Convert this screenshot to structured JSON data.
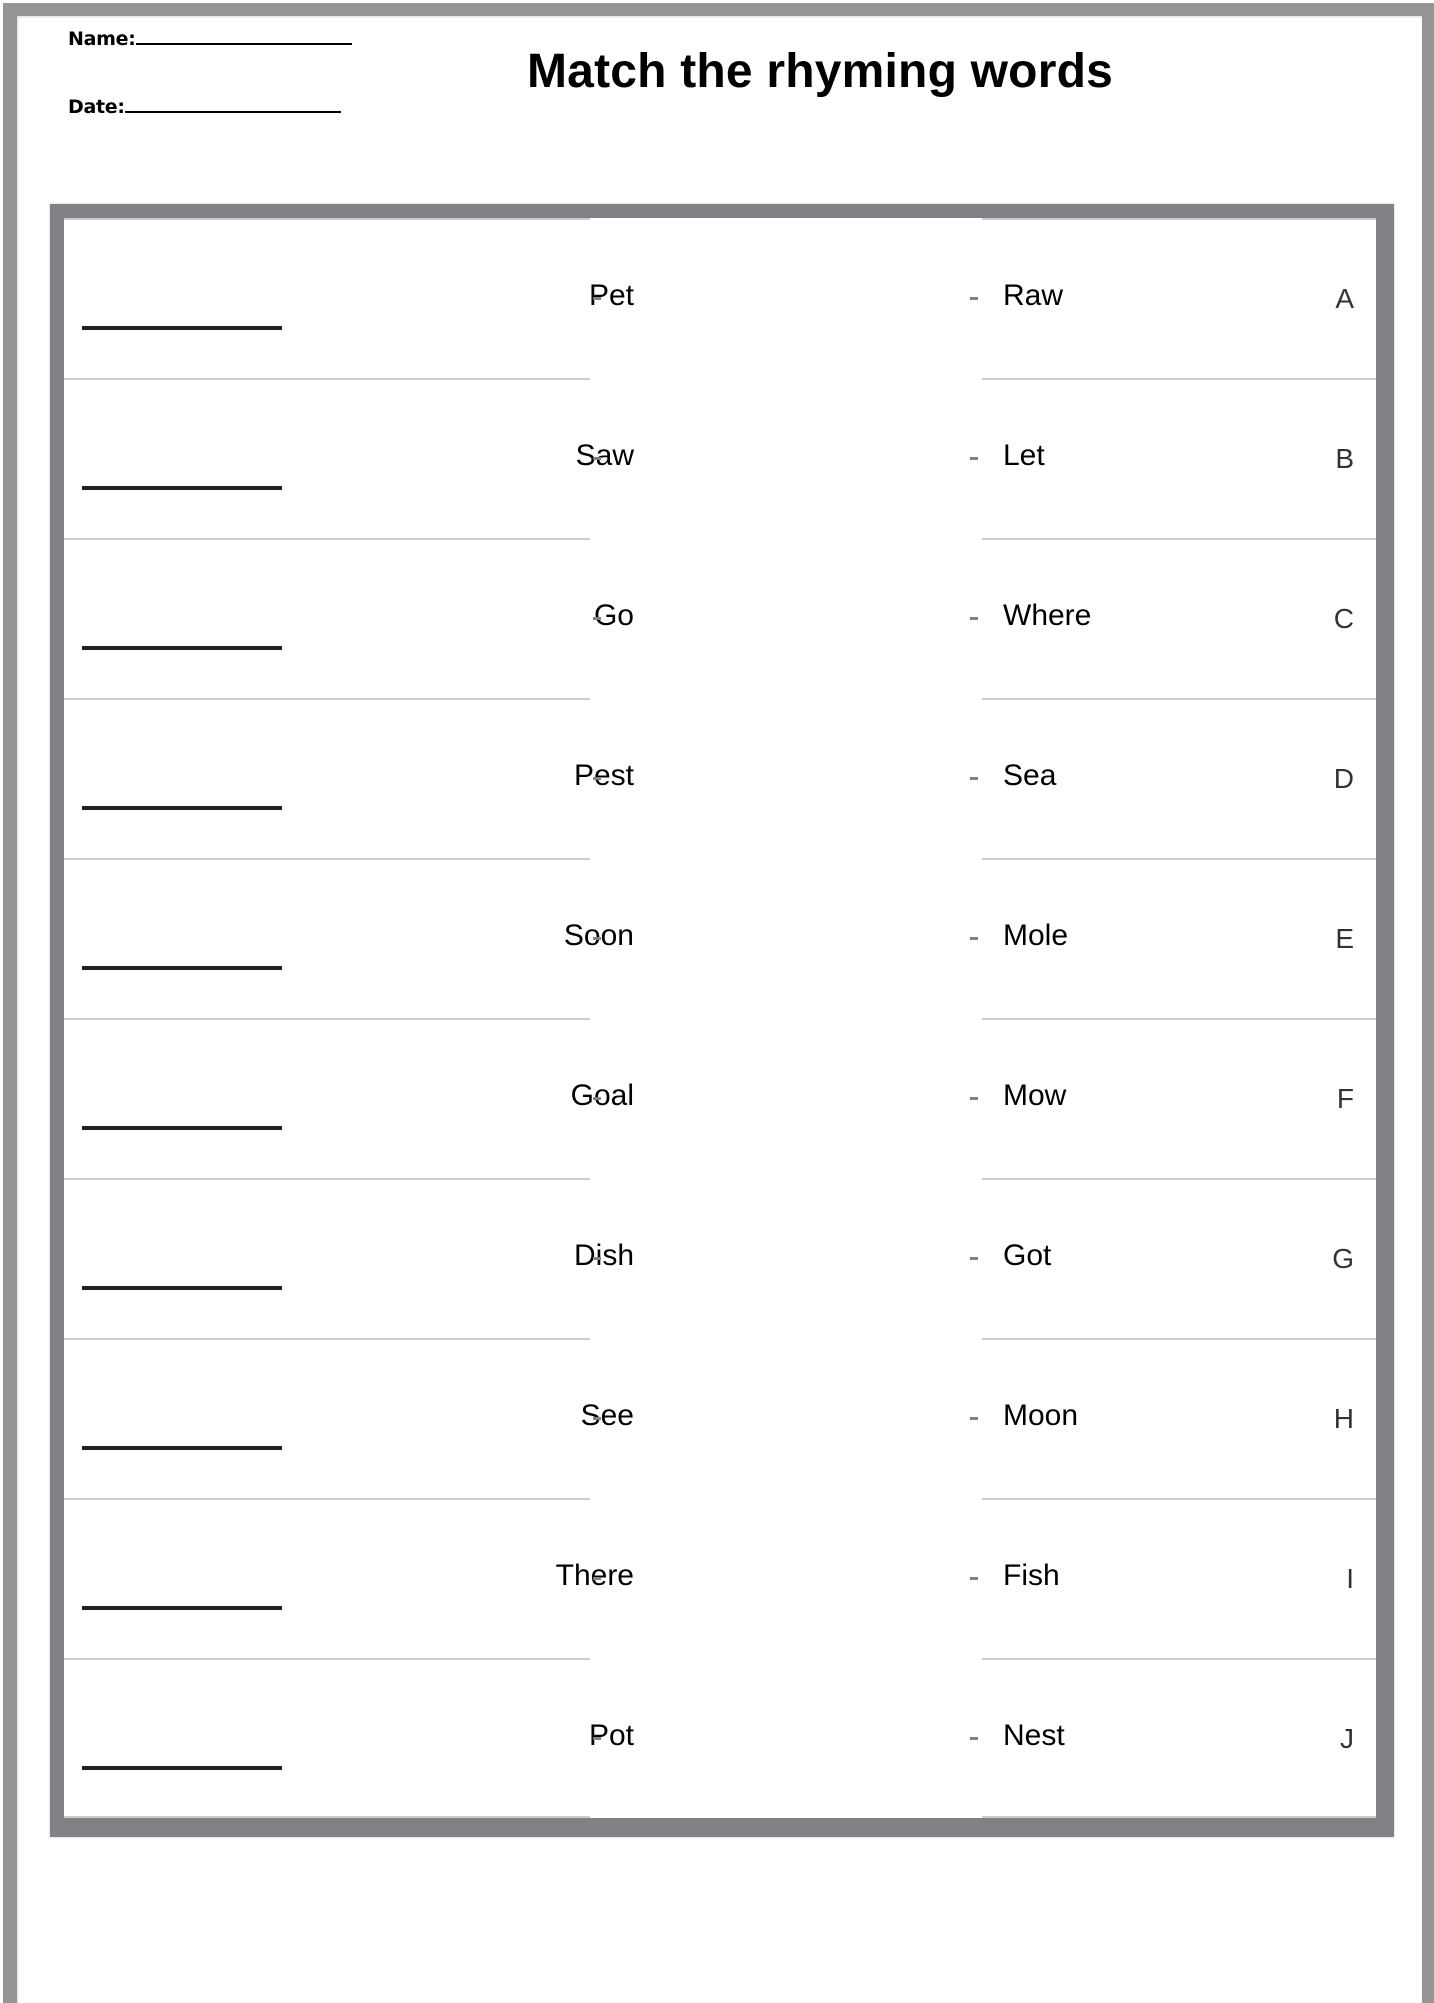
{
  "header": {
    "name_label": "Name:",
    "date_label": "Date:",
    "title": "Match the rhyming words"
  },
  "rows": [
    {
      "left": "Pet",
      "right": "Raw",
      "letter": "A"
    },
    {
      "left": "Saw",
      "right": "Let",
      "letter": "B"
    },
    {
      "left": "Go",
      "right": "Where",
      "letter": "C"
    },
    {
      "left": "Pest",
      "right": "Sea",
      "letter": "D"
    },
    {
      "left": "Soon",
      "right": "Mole",
      "letter": "E"
    },
    {
      "left": "Goal",
      "right": "Mow",
      "letter": "F"
    },
    {
      "left": "Dish",
      "right": "Got",
      "letter": "G"
    },
    {
      "left": "See",
      "right": "Moon",
      "letter": "H"
    },
    {
      "left": "There",
      "right": "Fish",
      "letter": "I"
    },
    {
      "left": "Pot",
      "right": "Nest",
      "letter": "J"
    }
  ],
  "colors": {
    "outer_frame": "#959595",
    "box_border": "#808285",
    "row_divider": "#cccccc",
    "answer_line": "#222222"
  }
}
